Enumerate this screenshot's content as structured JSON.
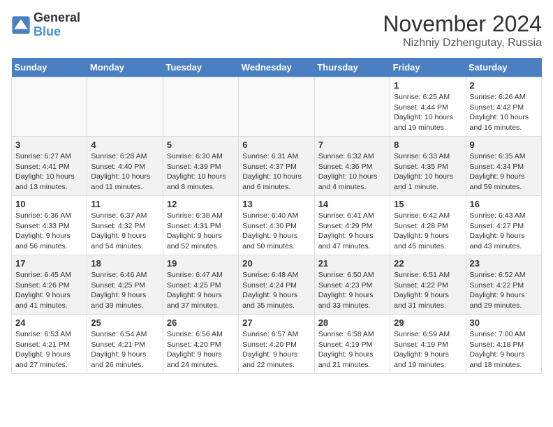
{
  "logo": {
    "text1": "General",
    "text2": "Blue"
  },
  "header": {
    "month": "November 2024",
    "location": "Nizhniy Dzhengutay, Russia"
  },
  "weekdays": [
    "Sunday",
    "Monday",
    "Tuesday",
    "Wednesday",
    "Thursday",
    "Friday",
    "Saturday"
  ],
  "weeks": [
    [
      {
        "day": "",
        "info": ""
      },
      {
        "day": "",
        "info": ""
      },
      {
        "day": "",
        "info": ""
      },
      {
        "day": "",
        "info": ""
      },
      {
        "day": "",
        "info": ""
      },
      {
        "day": "1",
        "info": "Sunrise: 6:25 AM\nSunset: 4:44 PM\nDaylight: 10 hours and 19 minutes."
      },
      {
        "day": "2",
        "info": "Sunrise: 6:26 AM\nSunset: 4:42 PM\nDaylight: 10 hours and 16 minutes."
      }
    ],
    [
      {
        "day": "3",
        "info": "Sunrise: 6:27 AM\nSunset: 4:41 PM\nDaylight: 10 hours and 13 minutes."
      },
      {
        "day": "4",
        "info": "Sunrise: 6:28 AM\nSunset: 4:40 PM\nDaylight: 10 hours and 11 minutes."
      },
      {
        "day": "5",
        "info": "Sunrise: 6:30 AM\nSunset: 4:39 PM\nDaylight: 10 hours and 8 minutes."
      },
      {
        "day": "6",
        "info": "Sunrise: 6:31 AM\nSunset: 4:37 PM\nDaylight: 10 hours and 6 minutes."
      },
      {
        "day": "7",
        "info": "Sunrise: 6:32 AM\nSunset: 4:36 PM\nDaylight: 10 hours and 4 minutes."
      },
      {
        "day": "8",
        "info": "Sunrise: 6:33 AM\nSunset: 4:35 PM\nDaylight: 10 hours and 1 minute."
      },
      {
        "day": "9",
        "info": "Sunrise: 6:35 AM\nSunset: 4:34 PM\nDaylight: 9 hours and 59 minutes."
      }
    ],
    [
      {
        "day": "10",
        "info": "Sunrise: 6:36 AM\nSunset: 4:33 PM\nDaylight: 9 hours and 56 minutes."
      },
      {
        "day": "11",
        "info": "Sunrise: 6:37 AM\nSunset: 4:32 PM\nDaylight: 9 hours and 54 minutes."
      },
      {
        "day": "12",
        "info": "Sunrise: 6:38 AM\nSunset: 4:31 PM\nDaylight: 9 hours and 52 minutes."
      },
      {
        "day": "13",
        "info": "Sunrise: 6:40 AM\nSunset: 4:30 PM\nDaylight: 9 hours and 50 minutes."
      },
      {
        "day": "14",
        "info": "Sunrise: 6:41 AM\nSunset: 4:29 PM\nDaylight: 9 hours and 47 minutes."
      },
      {
        "day": "15",
        "info": "Sunrise: 6:42 AM\nSunset: 4:28 PM\nDaylight: 9 hours and 45 minutes."
      },
      {
        "day": "16",
        "info": "Sunrise: 6:43 AM\nSunset: 4:27 PM\nDaylight: 9 hours and 43 minutes."
      }
    ],
    [
      {
        "day": "17",
        "info": "Sunrise: 6:45 AM\nSunset: 4:26 PM\nDaylight: 9 hours and 41 minutes."
      },
      {
        "day": "18",
        "info": "Sunrise: 6:46 AM\nSunset: 4:25 PM\nDaylight: 9 hours and 39 minutes."
      },
      {
        "day": "19",
        "info": "Sunrise: 6:47 AM\nSunset: 4:25 PM\nDaylight: 9 hours and 37 minutes."
      },
      {
        "day": "20",
        "info": "Sunrise: 6:48 AM\nSunset: 4:24 PM\nDaylight: 9 hours and 35 minutes."
      },
      {
        "day": "21",
        "info": "Sunrise: 6:50 AM\nSunset: 4:23 PM\nDaylight: 9 hours and 33 minutes."
      },
      {
        "day": "22",
        "info": "Sunrise: 6:51 AM\nSunset: 4:22 PM\nDaylight: 9 hours and 31 minutes."
      },
      {
        "day": "23",
        "info": "Sunrise: 6:52 AM\nSunset: 4:22 PM\nDaylight: 9 hours and 29 minutes."
      }
    ],
    [
      {
        "day": "24",
        "info": "Sunrise: 6:53 AM\nSunset: 4:21 PM\nDaylight: 9 hours and 27 minutes."
      },
      {
        "day": "25",
        "info": "Sunrise: 6:54 AM\nSunset: 4:21 PM\nDaylight: 9 hours and 26 minutes."
      },
      {
        "day": "26",
        "info": "Sunrise: 6:56 AM\nSunset: 4:20 PM\nDaylight: 9 hours and 24 minutes."
      },
      {
        "day": "27",
        "info": "Sunrise: 6:57 AM\nSunset: 4:20 PM\nDaylight: 9 hours and 22 minutes."
      },
      {
        "day": "28",
        "info": "Sunrise: 6:58 AM\nSunset: 4:19 PM\nDaylight: 9 hours and 21 minutes."
      },
      {
        "day": "29",
        "info": "Sunrise: 6:59 AM\nSunset: 4:19 PM\nDaylight: 9 hours and 19 minutes."
      },
      {
        "day": "30",
        "info": "Sunrise: 7:00 AM\nSunset: 4:18 PM\nDaylight: 9 hours and 18 minutes."
      }
    ]
  ]
}
